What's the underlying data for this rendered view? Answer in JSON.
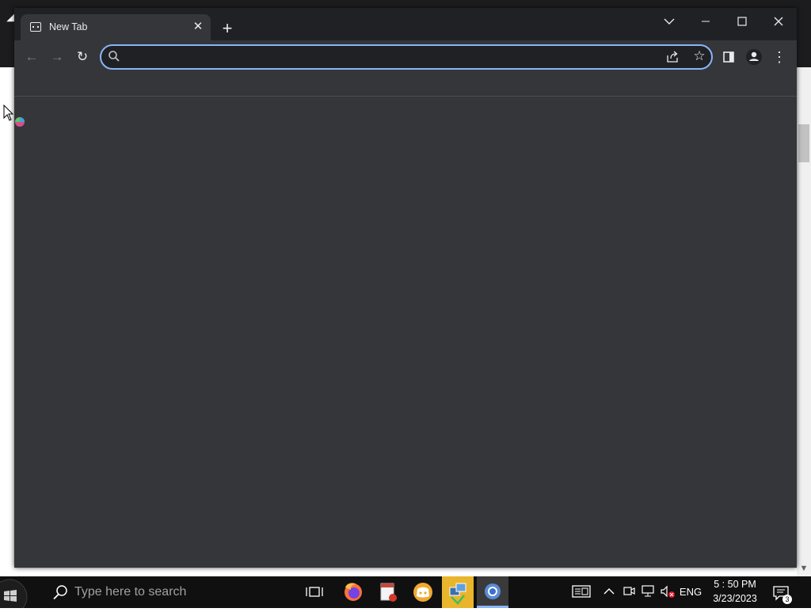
{
  "browser": {
    "tab": {
      "title": "New Tab",
      "favicon": "sad-face-icon",
      "close_label": "✕"
    },
    "new_tab_label": "+",
    "window_controls": {
      "tab_search": "⌄",
      "minimize": "—",
      "maximize": "☐",
      "close": "✕"
    },
    "toolbar": {
      "back": "←",
      "forward": "→",
      "reload": "↻",
      "address_value": "",
      "star": "☆",
      "menu": "⋮"
    },
    "colors": {
      "frame": "#202124",
      "toolbar": "#35363a",
      "accent": "#8ab4f8"
    }
  },
  "taskbar": {
    "search_placeholder": "Type here to search",
    "apps": [
      {
        "name": "firefox",
        "active": false
      },
      {
        "name": "document-app",
        "active": false
      },
      {
        "name": "discord",
        "active": false
      },
      {
        "name": "network-app",
        "active": false
      },
      {
        "name": "chrome",
        "active": true
      }
    ],
    "tray": {
      "language": "ENG",
      "time": "5 : 50 PM",
      "date": "3/23/2023",
      "notifications_count": "3"
    }
  }
}
